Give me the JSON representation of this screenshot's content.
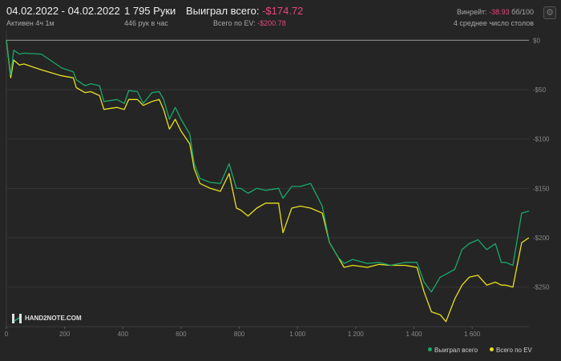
{
  "header": {
    "date_range": "04.02.2022 - 04.02.2022",
    "active": "Активен 4ч 1м",
    "hands": "1 795 Руки",
    "hands_per_hour": "446 рук в час",
    "won_label": "Выиграл всего:",
    "won_value": "-$174.72",
    "ev_label": "Всего по EV:",
    "ev_value": "-$200.78",
    "winrate_label": "Винрейт:",
    "winrate_value": "-38.93",
    "winrate_unit": "бб/100",
    "tables": "4 среднее число столов"
  },
  "logo": {
    "text": "HAND2NOTE.COM"
  },
  "legend": {
    "won": "Выиграл всего",
    "ev": "Всего по EV"
  },
  "colors": {
    "won": "#1aa86a",
    "ev": "#e8e020",
    "negative": "#e8467c",
    "zero_line": "#8c8c8c"
  },
  "icons": {
    "settings": "gear-icon"
  },
  "chart_data": {
    "type": "line",
    "xlim": [
      0,
      1795
    ],
    "ylim": [
      -290,
      10
    ],
    "x_ticks": [
      0,
      200,
      400,
      600,
      800,
      1000,
      1200,
      1400,
      1600
    ],
    "x_tick_labels": [
      "0",
      "200",
      "400",
      "600",
      "800",
      "1 000",
      "1 200",
      "1 400",
      "1 600"
    ],
    "y_ticks": [
      0,
      -50,
      -100,
      -150,
      -200,
      -250
    ],
    "y_tick_labels": [
      "$0",
      "-$50",
      "-$100",
      "-$150",
      "-$200",
      "-$250"
    ],
    "series": [
      {
        "name": "Выиграл всего",
        "color": "#1aa86a",
        "x": [
          0,
          15,
          25,
          45,
          60,
          120,
          190,
          230,
          240,
          270,
          290,
          320,
          335,
          380,
          405,
          420,
          450,
          470,
          500,
          525,
          540,
          560,
          580,
          600,
          630,
          645,
          665,
          700,
          735,
          765,
          790,
          805,
          830,
          860,
          890,
          935,
          950,
          980,
          1010,
          1045,
          1085,
          1110,
          1140,
          1160,
          1190,
          1240,
          1280,
          1320,
          1370,
          1410,
          1435,
          1460,
          1490,
          1510,
          1540,
          1565,
          1590,
          1620,
          1650,
          1680,
          1700,
          1715,
          1740,
          1770,
          1795
        ],
        "y": [
          0,
          -35,
          -10,
          -14,
          -13,
          -14,
          -28,
          -32,
          -40,
          -46,
          -44,
          -46,
          -62,
          -60,
          -64,
          -51,
          -52,
          -64,
          -53,
          -52,
          -60,
          -80,
          -68,
          -80,
          -95,
          -125,
          -140,
          -144,
          -145,
          -125,
          -150,
          -150,
          -155,
          -150,
          -152,
          -150,
          -160,
          -148,
          -148,
          -145,
          -168,
          -205,
          -220,
          -226,
          -222,
          -226,
          -225,
          -228,
          -225,
          -225,
          -245,
          -255,
          -240,
          -237,
          -232,
          -212,
          -206,
          -202,
          -212,
          -206,
          -225,
          -225,
          -228,
          -175,
          -173
        ]
      },
      {
        "name": "Всего по EV",
        "color": "#e8e020",
        "x": [
          0,
          15,
          25,
          45,
          60,
          120,
          190,
          230,
          240,
          270,
          290,
          320,
          335,
          380,
          405,
          420,
          450,
          470,
          500,
          525,
          540,
          560,
          580,
          600,
          630,
          645,
          665,
          700,
          735,
          765,
          790,
          805,
          830,
          860,
          890,
          935,
          950,
          980,
          1010,
          1045,
          1085,
          1110,
          1140,
          1160,
          1190,
          1240,
          1280,
          1320,
          1370,
          1410,
          1435,
          1460,
          1490,
          1510,
          1540,
          1565,
          1590,
          1620,
          1650,
          1680,
          1700,
          1715,
          1740,
          1770,
          1795
        ],
        "y": [
          0,
          -38,
          -20,
          -25,
          -24,
          -30,
          -36,
          -38,
          -48,
          -53,
          -52,
          -56,
          -70,
          -68,
          -70,
          -60,
          -60,
          -66,
          -62,
          -60,
          -70,
          -90,
          -80,
          -92,
          -105,
          -130,
          -145,
          -150,
          -153,
          -135,
          -170,
          -172,
          -178,
          -170,
          -165,
          -165,
          -195,
          -170,
          -168,
          -170,
          -175,
          -205,
          -220,
          -230,
          -228,
          -230,
          -227,
          -228,
          -228,
          -230,
          -255,
          -275,
          -278,
          -285,
          -262,
          -248,
          -240,
          -238,
          -248,
          -245,
          -248,
          -248,
          -250,
          -205,
          -200
        ]
      }
    ]
  }
}
